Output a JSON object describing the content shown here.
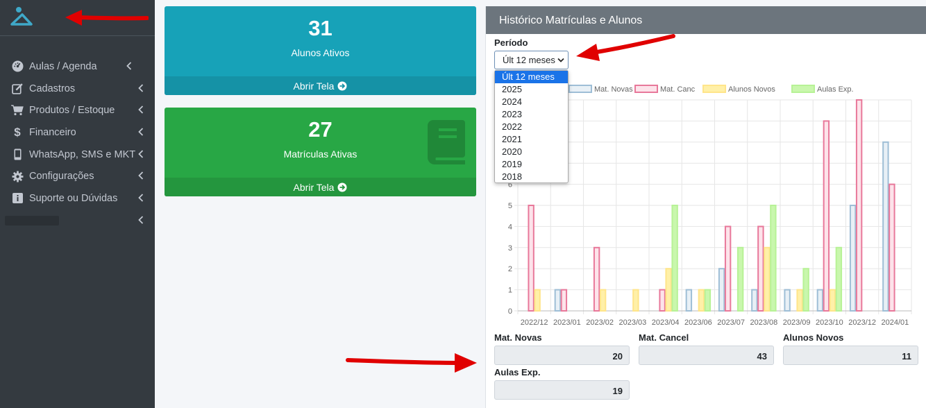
{
  "sidebar": {
    "items": [
      {
        "label": "Aulas / Agenda",
        "icon": "dashboard-icon"
      },
      {
        "label": "Cadastros",
        "icon": "edit-icon"
      },
      {
        "label": "Produtos / Estoque",
        "icon": "cart-icon"
      },
      {
        "label": "Financeiro",
        "icon": "dollar-icon"
      },
      {
        "label": "WhatsApp, SMS e MKT",
        "icon": "mobile-icon"
      },
      {
        "label": "Configurações",
        "icon": "gear-icon"
      },
      {
        "label": "Suporte ou Dúvidas",
        "icon": "info-icon"
      }
    ]
  },
  "cards": [
    {
      "value": "31",
      "label": "Alunos Ativos",
      "link": "Abrir Tela"
    },
    {
      "value": "27",
      "label": "Matrículas Ativas",
      "link": "Abrir Tela"
    }
  ],
  "panel": {
    "title": "Histórico Matrículas e Alunos",
    "periodo_label": "Período",
    "selected": "Últ 12 meses",
    "options": [
      "Últ 12 meses",
      "2025",
      "2024",
      "2023",
      "2022",
      "2021",
      "2020",
      "2019",
      "2018"
    ]
  },
  "chart_data": {
    "type": "bar",
    "categories": [
      "2022/12",
      "2023/01",
      "2023/02",
      "2023/03",
      "2023/04",
      "2023/06",
      "2023/07",
      "2023/08",
      "2023/09",
      "2023/10",
      "2023/12",
      "2024/01"
    ],
    "series": [
      {
        "name": "Mat. Novas",
        "color": "#9ebed6",
        "fill": "#e8f0f6",
        "values": [
          0,
          1,
          0,
          0,
          0,
          1,
          2,
          1,
          1,
          1,
          5,
          8
        ]
      },
      {
        "name": "Mat. Canc",
        "color": "#e8789a",
        "fill": "#fde3ea",
        "values": [
          5,
          1,
          3,
          0,
          1,
          0,
          4,
          4,
          0,
          9,
          10,
          6
        ]
      },
      {
        "name": "Alunos Novos",
        "color": "#ffe58a",
        "fill": "#fff0a8",
        "values": [
          1,
          0,
          1,
          1,
          2,
          1,
          0,
          3,
          1,
          1,
          0,
          0
        ]
      },
      {
        "name": "Aulas Exp.",
        "color": "#b7f296",
        "fill": "#c9f7ad",
        "values": [
          0,
          0,
          0,
          0,
          5,
          1,
          3,
          5,
          2,
          3,
          0,
          0
        ]
      }
    ],
    "y_ticks": [
      "0",
      "1",
      "2",
      "3",
      "4",
      "5",
      "6"
    ],
    "ylim": [
      0,
      10
    ],
    "grid": true,
    "legend": "top"
  },
  "stats": [
    {
      "label": "Mat. Novas",
      "value": "20"
    },
    {
      "label": "Mat. Cancel",
      "value": "43"
    },
    {
      "label": "Alunos Novos",
      "value": "11"
    },
    {
      "label": "Aulas Exp.",
      "value": "19"
    }
  ],
  "colors": {
    "sidebar": "#343a40",
    "info": "#17a2b8",
    "success": "#28a745",
    "panel_header": "#6c757d",
    "annotation": "#e00000"
  }
}
